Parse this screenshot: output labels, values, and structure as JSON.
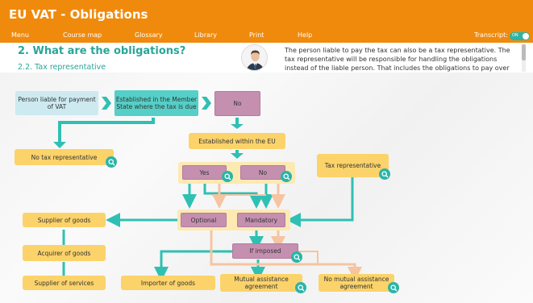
{
  "app": {
    "title": "EU VAT - Obligations"
  },
  "menu": {
    "items": [
      "Menu",
      "Course map",
      "Glossary",
      "Library",
      "Print",
      "Help"
    ],
    "transcript_label": "Transcript:",
    "transcript_toggle": "ON"
  },
  "page": {
    "heading": "2. What are the obligations?",
    "subheading": "2.2. Tax representative",
    "transcript_text": "The person liable to pay the tax can also be a tax representative. The tax representative will be responsible for handling the obligations instead of the liable person. That includes the obligations to pay over"
  },
  "diagram": {
    "person_liable": "Person liable for payment of VAT",
    "established_ms": "Established in the Member State where the tax is due",
    "no_top": "No",
    "no_tax_rep": "No tax representative",
    "established_eu": "Established within the EU",
    "yes": "Yes",
    "no": "No",
    "tax_rep": "Tax representative",
    "optional": "Optional",
    "mandatory": "Mandatory",
    "supplier_goods": "Supplier of goods",
    "acquirer_goods": "Acquirer of goods",
    "supplier_services": "Supplier of services",
    "importer_goods": "Importer of goods",
    "if_imposed": "If imposed",
    "mutual_agreement": "Mutual assistance agreement",
    "no_mutual_agreement": "No mutual assistance agreement"
  },
  "colors": {
    "brand": "#f08a0c",
    "accent": "#2bb5a8",
    "arrow_teal": "#2fc0b3",
    "arrow_peach": "#f6c4a0"
  }
}
